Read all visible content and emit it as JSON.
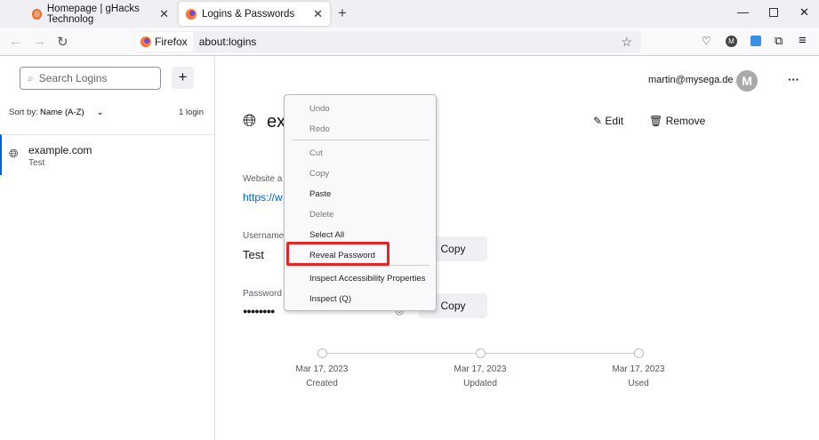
{
  "tabs": [
    {
      "title": "Homepage | gHacks Technolog",
      "icon": "ghacks-icon"
    },
    {
      "title": "Logins & Passwords",
      "icon": "firefox-icon"
    }
  ],
  "nav": {
    "identity": "Firefox",
    "url": "about:logins"
  },
  "sidebar": {
    "search_placeholder": "Search Logins",
    "sort_label": "Sort by:",
    "sort_value": "Name (A-Z)",
    "count": "1 login",
    "items": [
      {
        "title": "example.com",
        "username": "Test"
      }
    ]
  },
  "account": {
    "email": "martin@mysega.de",
    "avatar": "M"
  },
  "detail": {
    "title_visible": "ex",
    "edit": "Edit",
    "remove": "Remove",
    "website_label": "Website a",
    "website_value": "https://w",
    "username_label": "Username",
    "username_value": "Test",
    "password_label": "Password",
    "password_value": "●●●●●●●●",
    "copy": "Copy"
  },
  "menu": {
    "items": [
      "Undo",
      "Redo",
      "Cut",
      "Copy",
      "Paste",
      "Delete",
      "Select All",
      "Reveal Password",
      "Inspect Accessibility Properties",
      "Inspect (Q)"
    ]
  },
  "timeline": [
    {
      "date": "Mar 17, 2023",
      "label": "Created"
    },
    {
      "date": "Mar 17, 2023",
      "label": "Updated"
    },
    {
      "date": "Mar 17, 2023",
      "label": "Used"
    }
  ],
  "colors": {
    "accent": "#0061e0",
    "highlight": "#e22222"
  }
}
